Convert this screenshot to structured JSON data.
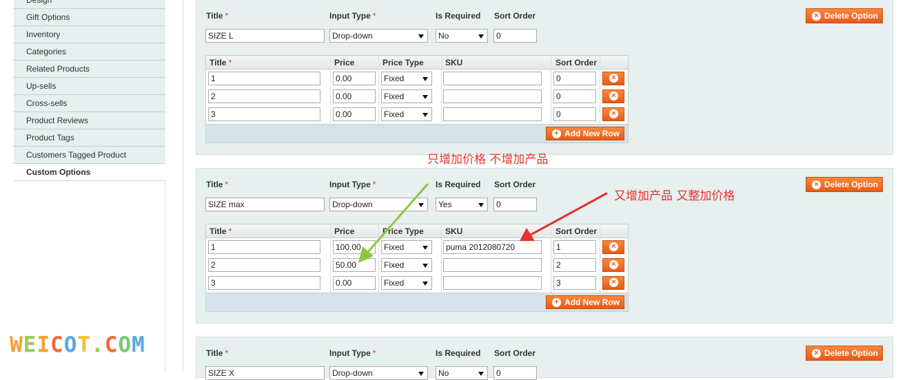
{
  "sidebar": {
    "items": [
      {
        "label": "Design",
        "active": false
      },
      {
        "label": "Gift Options",
        "active": false
      },
      {
        "label": "Inventory",
        "active": false
      },
      {
        "label": "Categories",
        "active": false
      },
      {
        "label": "Related Products",
        "active": false
      },
      {
        "label": "Up-sells",
        "active": false
      },
      {
        "label": "Cross-sells",
        "active": false
      },
      {
        "label": "Product Reviews",
        "active": false
      },
      {
        "label": "Product Tags",
        "active": false
      },
      {
        "label": "Customers Tagged Product",
        "active": false
      },
      {
        "label": "Custom Options",
        "active": true
      }
    ]
  },
  "watermark": {
    "letters": [
      {
        "ch": "W",
        "color": "#f2a33a"
      },
      {
        "ch": "E",
        "color": "#9ccc55"
      },
      {
        "ch": "I",
        "color": "#f2a33a"
      },
      {
        "ch": "C",
        "color": "#f06a3a"
      },
      {
        "ch": "O",
        "color": "#5aa9e0"
      },
      {
        "ch": "T",
        "color": "#f2c13a"
      },
      {
        "ch": ".",
        "color": "#9ccc55"
      },
      {
        "ch": "C",
        "color": "#f06a3a"
      },
      {
        "ch": "O",
        "color": "#7bc96f"
      },
      {
        "ch": "M",
        "color": "#5aa9e0"
      }
    ]
  },
  "labels": {
    "title": "Title",
    "required_mark": "*",
    "input_type": "Input Type",
    "is_required": "Is Required",
    "sort_order": "Sort Order",
    "delete_option": "Delete Option",
    "col_title": "Title",
    "col_price": "Price",
    "col_price_type": "Price Type",
    "col_sku": "SKU",
    "col_sort_order": "Sort Order",
    "add_new_row": "Add New Row"
  },
  "options": [
    {
      "title": "SIZE L",
      "input_type": "Drop-down",
      "is_required": "No",
      "sort_order": "0",
      "rows": [
        {
          "title": "1",
          "price": "0.00",
          "price_type": "Fixed",
          "sku": "",
          "sort_order": "0"
        },
        {
          "title": "2",
          "price": "0.00",
          "price_type": "Fixed",
          "sku": "",
          "sort_order": "0"
        },
        {
          "title": "3",
          "price": "0.00",
          "price_type": "Fixed",
          "sku": "",
          "sort_order": "0"
        }
      ]
    },
    {
      "title": "SIZE max",
      "input_type": "Drop-down",
      "is_required": "Yes",
      "sort_order": "0",
      "rows": [
        {
          "title": "1",
          "price": "100.00",
          "price_type": "Fixed",
          "sku": "puma 2012080720",
          "sort_order": "1"
        },
        {
          "title": "2",
          "price": "50.00",
          "price_type": "Fixed",
          "sku": "",
          "sort_order": "2"
        },
        {
          "title": "3",
          "price": "0.00",
          "price_type": "Fixed",
          "sku": "",
          "sort_order": "3"
        }
      ]
    },
    {
      "title": "SIZE X",
      "input_type": "Drop-down",
      "is_required": "No",
      "sort_order": "0",
      "rows": []
    }
  ],
  "annotations": {
    "note_price_only": "只增加价格 不增加产品",
    "note_product_and_price": "又增加产品 又整加价格",
    "green_arrow_color": "#8cc63f",
    "red_arrow_color": "#e8312c"
  },
  "colors": {
    "accent_orange": "#e85a16",
    "panel_bg": "#e7efef",
    "footer_bg": "#d6e2e9",
    "required_red": "#eb340a"
  }
}
